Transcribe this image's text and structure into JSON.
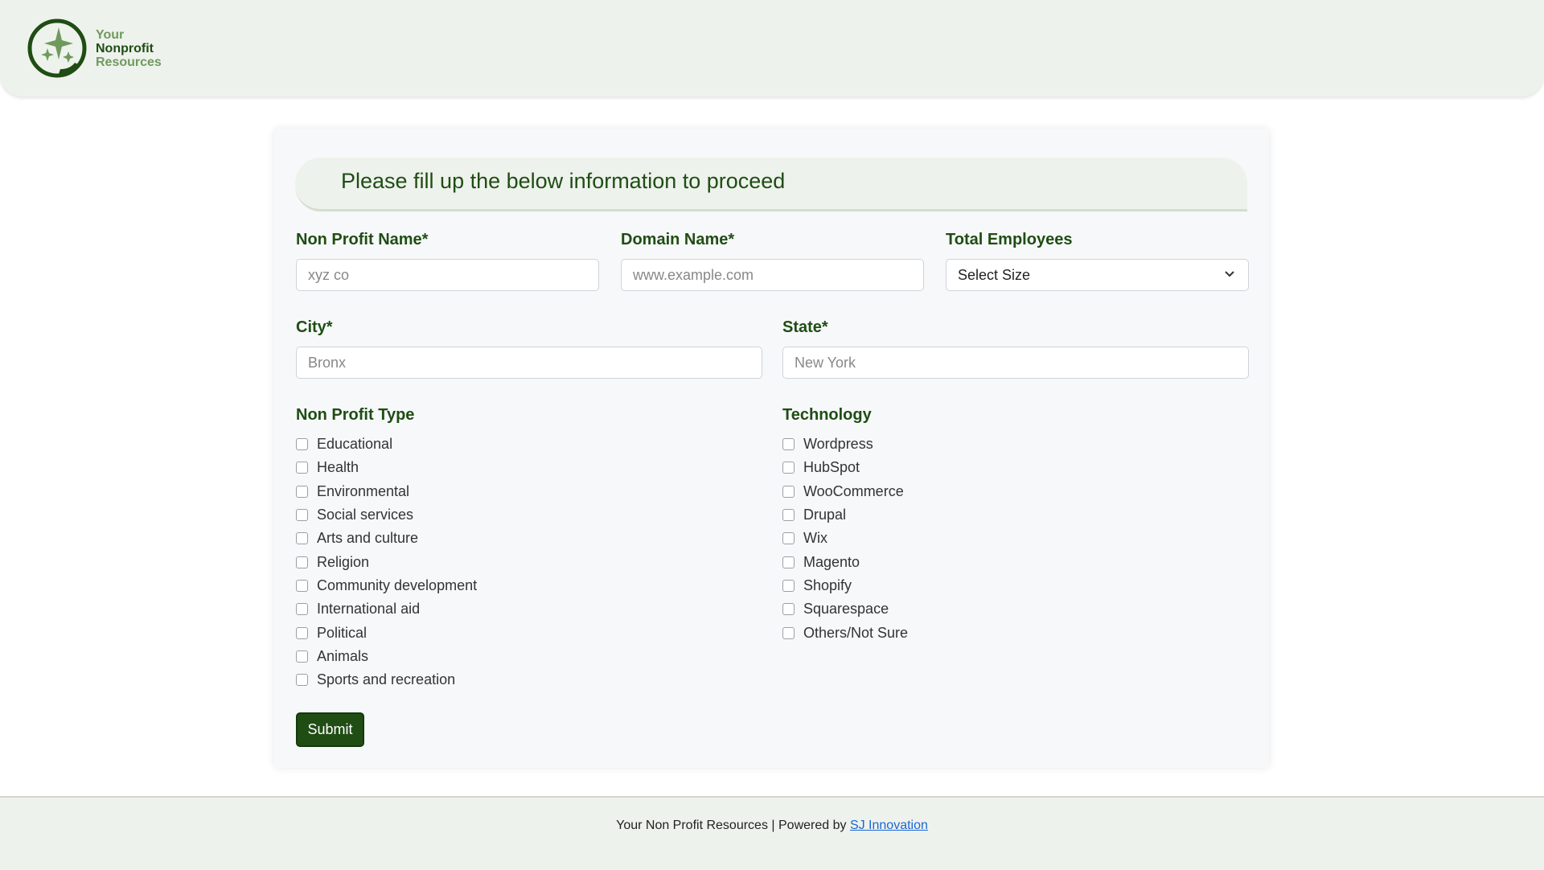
{
  "header": {
    "logo": {
      "line1": "Your",
      "line2": "Nonprofit",
      "line3": "Resources"
    }
  },
  "form": {
    "heading": "Please fill up the below information to proceed",
    "fields": {
      "nonprofit_name": {
        "label": "Non Profit Name*",
        "placeholder": "xyz co"
      },
      "domain_name": {
        "label": "Domain Name*",
        "placeholder": "www.example.com"
      },
      "total_employees": {
        "label": "Total Employees",
        "selected": "Select Size"
      },
      "city": {
        "label": "City*",
        "placeholder": "Bronx"
      },
      "state": {
        "label": "State*",
        "placeholder": "New York"
      }
    },
    "nonprofit_type": {
      "label": "Non Profit Type",
      "options": [
        "Educational",
        "Health",
        "Environmental",
        "Social services",
        "Arts and culture",
        "Religion",
        "Community development",
        "International aid",
        "Political",
        "Animals",
        "Sports and recreation"
      ]
    },
    "technology": {
      "label": "Technology",
      "options": [
        "Wordpress",
        "HubSpot",
        "WooCommerce",
        "Drupal",
        "Wix",
        "Magento",
        "Shopify",
        "Squarespace",
        "Others/Not Sure"
      ]
    },
    "submit_label": "Submit"
  },
  "footer": {
    "text": "Your Non Profit Resources | Powered by ",
    "link_text": "SJ Innovation"
  },
  "colors": {
    "brand_green": "#1f4d14",
    "header_bg": "#eef2ec",
    "link_blue": "#1a66d6"
  }
}
